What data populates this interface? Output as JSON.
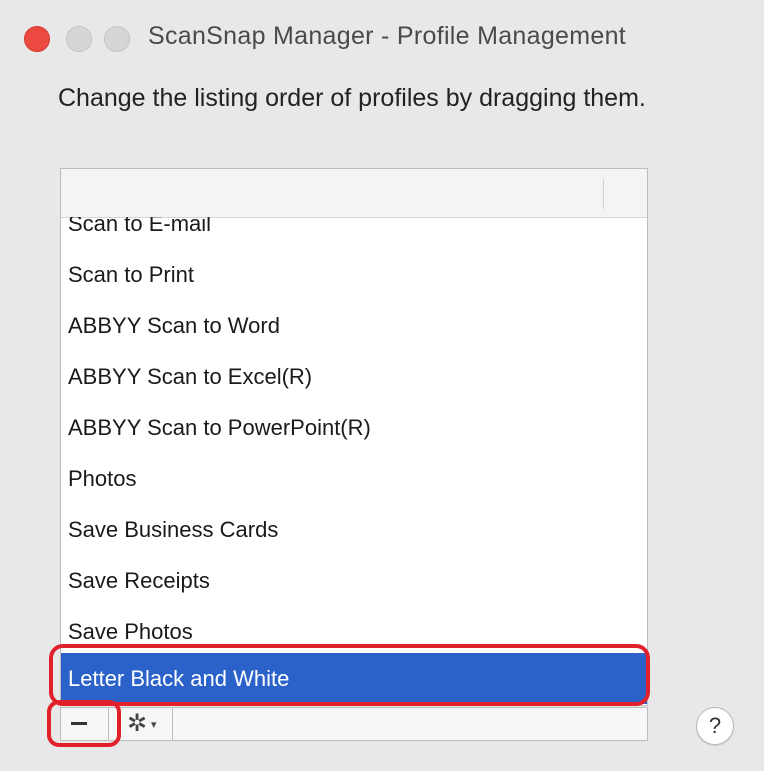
{
  "window": {
    "title": "ScanSnap Manager - Profile Management",
    "instruction": "Change the listing order of profiles by dragging them."
  },
  "profiles": {
    "items": [
      {
        "label": "Scan to E-mail",
        "selected": false
      },
      {
        "label": "Scan to Print",
        "selected": false
      },
      {
        "label": "ABBYY Scan to Word",
        "selected": false
      },
      {
        "label": "ABBYY Scan to Excel(R)",
        "selected": false
      },
      {
        "label": "ABBYY Scan to PowerPoint(R)",
        "selected": false
      },
      {
        "label": "Photos",
        "selected": false
      },
      {
        "label": "Save Business Cards",
        "selected": false
      },
      {
        "label": "Save Receipts",
        "selected": false
      },
      {
        "label": "Save Photos",
        "selected": false
      },
      {
        "label": "Letter Black and White",
        "selected": true
      }
    ]
  },
  "toolbar": {
    "remove_icon": "minus-icon",
    "gear_icon": "gear-icon",
    "gear_glyph": "✲",
    "dropdown_glyph": "▾"
  },
  "help": {
    "label": "?"
  },
  "colors": {
    "selection": "#2a62c9",
    "highlight": "#e0202a",
    "close_button": "#ec4a41"
  }
}
